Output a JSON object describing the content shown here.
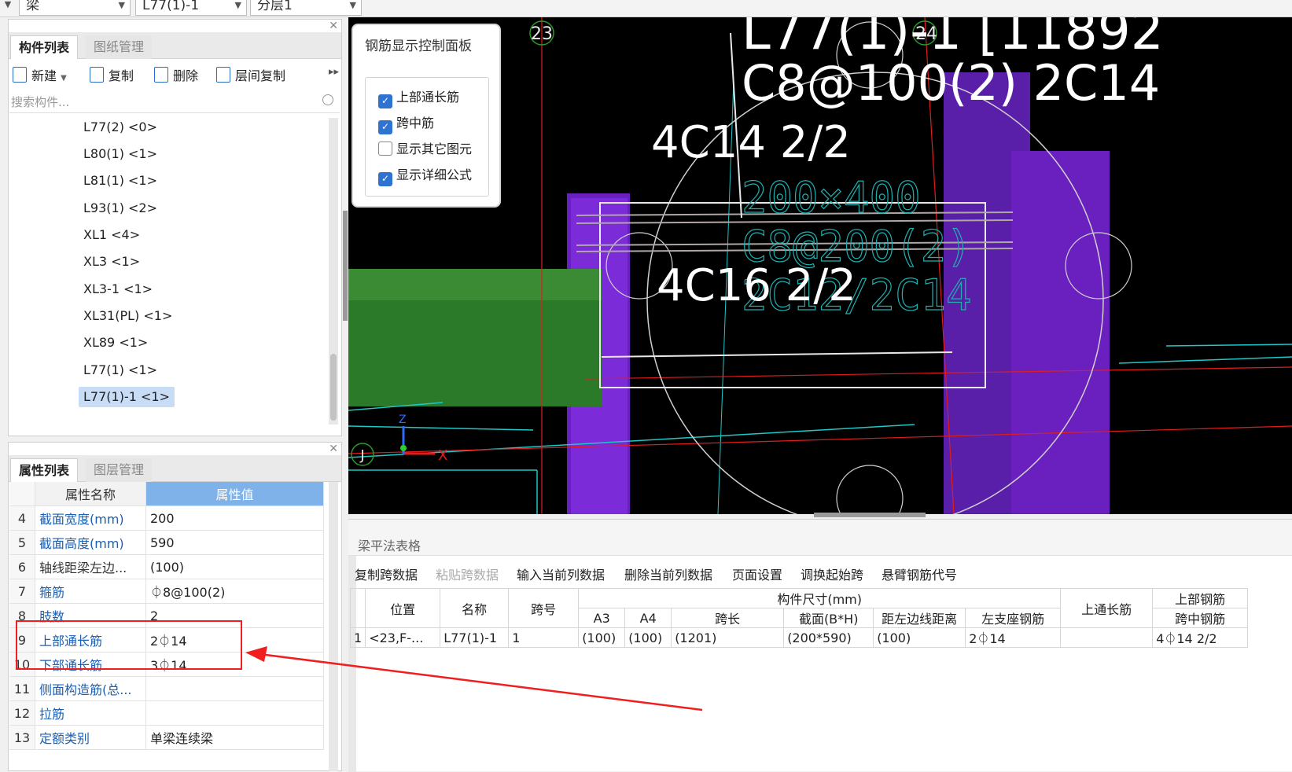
{
  "top": {
    "dropdowns": [
      "梁",
      "L77(1)-1",
      "分层1"
    ]
  },
  "component_panel": {
    "tabs": [
      "构件列表",
      "图纸管理"
    ],
    "toolbar": [
      "新建",
      "复制",
      "删除",
      "层间复制"
    ],
    "search_placeholder": "搜索构件...",
    "items": [
      "L77(2) <0>",
      "L80(1) <1>",
      "L81(1) <1>",
      "L93(1) <2>",
      "XL1 <4>",
      "XL3 <1>",
      "XL3-1 <1>",
      "XL31(PL) <1>",
      "XL89 <1>",
      "L77(1) <1>",
      "L77(1)-1 <1>"
    ],
    "selected": "L77(1)-1 <1>"
  },
  "property_panel": {
    "tabs": [
      "属性列表",
      "图层管理"
    ],
    "headers": [
      "属性名称",
      "属性值"
    ],
    "rows": [
      {
        "no": "4",
        "name": "截面宽度(mm)",
        "value": "200"
      },
      {
        "no": "5",
        "name": "截面高度(mm)",
        "value": "590"
      },
      {
        "no": "6",
        "name": "轴线距梁左边...",
        "value": "(100)"
      },
      {
        "no": "7",
        "name": "箍筋",
        "value": "⏀8@100(2)"
      },
      {
        "no": "8",
        "name": "肢数",
        "value": "2"
      },
      {
        "no": "9",
        "name": "上部通长筋",
        "value": "2⏀14"
      },
      {
        "no": "10",
        "name": "下部通长筋",
        "value": "3⏀14"
      },
      {
        "no": "11",
        "name": "侧面构造筋(总...",
        "value": ""
      },
      {
        "no": "12",
        "name": "拉筋",
        "value": ""
      },
      {
        "no": "13",
        "name": "定额类别",
        "value": "单梁连续梁"
      }
    ]
  },
  "control_panel": {
    "title": "钢筋显示控制面板",
    "options": [
      {
        "label": "上部通长筋",
        "checked": true
      },
      {
        "label": "跨中筋",
        "checked": true
      },
      {
        "label": "显示其它图元",
        "checked": false
      },
      {
        "label": "显示详细公式",
        "checked": true
      }
    ]
  },
  "viewport": {
    "axis_23": "23",
    "axis_24": "24",
    "axis_J": "J",
    "axis_x": "X",
    "axis_z": "Z",
    "text_title": "L77(1)-1 [11892",
    "text_stirrup": "C8@100(2) 2C14",
    "text_top": "4C14 2/2",
    "text_section": "200×400",
    "text_stirrup2": "C8@200(2)",
    "text_bottom": "4C16 2/2",
    "text_bottom2": "2C12/2C14"
  },
  "bottom_panel": {
    "title": "梁平法表格",
    "toolbar": [
      {
        "label": "复制跨数据",
        "disabled": false
      },
      {
        "label": "粘贴跨数据",
        "disabled": true
      },
      {
        "label": "输入当前列数据",
        "disabled": false
      },
      {
        "label": "删除当前列数据",
        "disabled": false
      },
      {
        "label": "页面设置",
        "disabled": false
      },
      {
        "label": "调换起始跨",
        "disabled": false
      },
      {
        "label": "悬臂钢筋代号",
        "disabled": false
      }
    ],
    "group_headers": {
      "size": "构件尺寸(mm)",
      "top_rebar": "上部钢筋"
    },
    "headers": {
      "position": "位置",
      "name": "名称",
      "span_no": "跨号",
      "a3": "A3",
      "a4": "A4",
      "span_len": "跨长",
      "section": "截面(B*H)",
      "left_dist": "距左边线距离",
      "top_through": "上通长筋",
      "left_seat": "左支座钢筋",
      "mid": "跨中钢筋"
    },
    "row": {
      "index": "1",
      "position": "<23,F-...",
      "name": "L77(1)-1",
      "span_no": "1",
      "a3": "(100)",
      "a4": "(100)",
      "span_len": "(1201)",
      "section": "(200*590)",
      "left_dist": "(100)",
      "top_through": "2⏀14",
      "left_seat": "",
      "mid": "4⏀14 2/2"
    }
  },
  "colors": {
    "red_annotation": "#f01e1e",
    "selection": "#c9dcf5",
    "header_blue": "#7fb2e8",
    "link_blue": "#1a5fb4",
    "checkbox_blue": "#2f73d0"
  }
}
